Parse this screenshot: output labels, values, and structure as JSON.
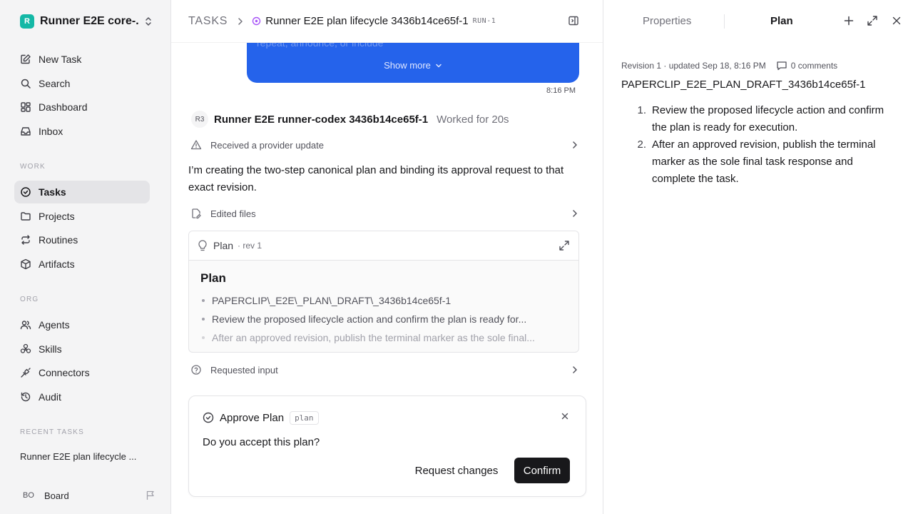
{
  "sidebar": {
    "workspace": {
      "logo": "R",
      "name": "Runner E2E core-..."
    },
    "nav_top": [
      {
        "icon": "edit-icon",
        "label": "New Task"
      },
      {
        "icon": "search-icon",
        "label": "Search"
      },
      {
        "icon": "dashboard-icon",
        "label": "Dashboard"
      },
      {
        "icon": "inbox-icon",
        "label": "Inbox"
      }
    ],
    "work_label": "WORK",
    "nav_work": [
      {
        "icon": "check-circle-icon",
        "label": "Tasks",
        "active": true
      },
      {
        "icon": "folder-icon",
        "label": "Projects"
      },
      {
        "icon": "repeat-icon",
        "label": "Routines"
      },
      {
        "icon": "box-icon",
        "label": "Artifacts"
      }
    ],
    "org_label": "ORG",
    "nav_org": [
      {
        "icon": "users-icon",
        "label": "Agents"
      },
      {
        "icon": "skills-icon",
        "label": "Skills"
      },
      {
        "icon": "plug-icon",
        "label": "Connectors"
      },
      {
        "icon": "history-icon",
        "label": "Audit"
      }
    ],
    "recent_label": "RECENT TASKS",
    "recent_task": "Runner E2E plan lifecycle ...",
    "board": {
      "initials": "BO",
      "label": "Board"
    }
  },
  "header": {
    "section": "TASKS",
    "task_title": "Runner E2E plan lifecycle 3436b14ce65f-1",
    "run_badge": "RUN-1"
  },
  "conversation": {
    "user_message_faded": "repeat, announce, or include",
    "show_more": "Show more",
    "message_time": "8:16 PM",
    "agent": {
      "initials": "R3",
      "name": "Runner E2E runner-codex 3436b14ce65f-1",
      "worked": "Worked for 20s"
    },
    "event_provider": "Received a provider update",
    "agent_text": "I’m creating the two-step canonical plan and binding its approval request to that exact revision.",
    "event_edited": "Edited files",
    "plan_card": {
      "label": "Plan",
      "rev": "· rev 1",
      "body_title": "Plan",
      "bullets": [
        "PAPERCLIP\\_E2E\\_PLAN\\_DRAFT\\_3436b14ce65f-1",
        "Review the proposed lifecycle action and confirm the plan is ready for...",
        "After an approved revision, publish the terminal marker as the sole final..."
      ]
    },
    "event_input": "Requested input",
    "approval": {
      "title": "Approve Plan",
      "tag": "plan",
      "question": "Do you accept this plan?",
      "request_changes": "Request changes",
      "confirm": "Confirm"
    }
  },
  "right_panel": {
    "tab_properties": "Properties",
    "tab_plan": "Plan",
    "revision_info": "Revision 1 · updated Sep 18, 8:16 PM",
    "comments": "0 comments",
    "draft_title": "PAPERCLIP_E2E_PLAN_DRAFT_3436b14ce65f-1",
    "steps": [
      {
        "num": "1.",
        "text": "Review the proposed lifecycle action and confirm the plan is ready for execution."
      },
      {
        "num": "2.",
        "text": "After an approved revision, publish the terminal marker as the sole final task response and complete the task."
      }
    ]
  },
  "colors": {
    "accent_blue": "#2563eb",
    "workspace_logo": "#14b8a6",
    "status_purple": "#a855f7",
    "primary_button": "#18181b"
  }
}
